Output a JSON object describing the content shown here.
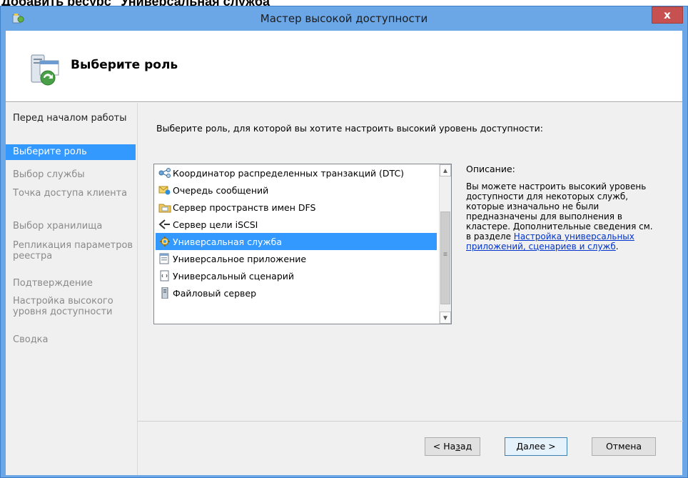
{
  "page_heading": "Добавить ресурс \"Универсальная служба\"",
  "window": {
    "title": "Мастер высокой доступности",
    "close_label": "x"
  },
  "header": {
    "title": "Выберите роль"
  },
  "nav": {
    "items": [
      {
        "label": "Перед началом работы",
        "state": "normal"
      },
      {
        "label": "Выберите роль",
        "state": "active"
      },
      {
        "label": "Выбор службы",
        "state": "disabled"
      },
      {
        "label": "Точка доступа клиента",
        "state": "disabled"
      },
      {
        "label": "Выбор хранилища",
        "state": "disabled"
      },
      {
        "label": "Репликация параметров реестра",
        "state": "disabled"
      },
      {
        "label": "Подтверждение",
        "state": "disabled"
      },
      {
        "label": "Настройка высокого уровня доступности",
        "state": "disabled"
      },
      {
        "label": "Сводка",
        "state": "disabled"
      }
    ]
  },
  "content": {
    "prompt": "Выберите роль, для которой вы хотите настроить высокий уровень доступности:",
    "roles": [
      {
        "label": "Координатор распределенных транзакций (DTC)",
        "icon": "dtc-icon",
        "selected": false
      },
      {
        "label": "Очередь сообщений",
        "icon": "message-queue-icon",
        "selected": false
      },
      {
        "label": "Сервер пространств имен DFS",
        "icon": "dfs-namespace-icon",
        "selected": false
      },
      {
        "label": "Сервер цели iSCSI",
        "icon": "iscsi-target-icon",
        "selected": false
      },
      {
        "label": "Универсальная служба",
        "icon": "gear-icon",
        "selected": true
      },
      {
        "label": "Универсальное приложение",
        "icon": "application-icon",
        "selected": false
      },
      {
        "label": "Универсальный сценарий",
        "icon": "script-icon",
        "selected": false
      },
      {
        "label": "Файловый сервер",
        "icon": "file-server-icon",
        "selected": false
      }
    ],
    "description_label": "Описание:",
    "description_text": "Вы можете настроить высокий уровень доступности для некоторых служб, которые изначально не были предназначены для выполнения в кластере. Дополнительные сведения см. в разделе ",
    "description_link": "Настройка универсальных приложений, сценариев и служб",
    "description_end": "."
  },
  "buttons": {
    "back_prefix": "< На",
    "back_accel": "з",
    "back_suffix": "ад",
    "next_accel": "Д",
    "next_suffix": "алее >",
    "cancel": "Отмена"
  },
  "colors": {
    "titlebar": "#6ba6e6",
    "selection": "#3399ff",
    "close": "#c75050",
    "link": "#0033cc"
  }
}
